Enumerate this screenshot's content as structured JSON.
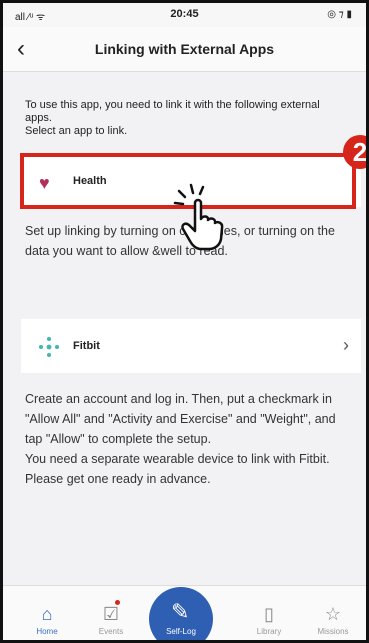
{
  "status_bar": {
    "signal": "all ⁄ᵘ ᯤ",
    "time": "20:45",
    "battery": "◎ ⁊ ▮"
  },
  "header": {
    "title": "Linking with External Apps"
  },
  "intro": {
    "text": "To use this app, you need to link it with the following external apps.\nSelect an app to link."
  },
  "apps": [
    {
      "label": "Health",
      "description": "Set up linking by turning on categories, or turning on the data you want to allow &well to read."
    },
    {
      "label": "Fitbit",
      "description": "Create an account and log in. Then, put a checkmark in \"Allow All\" and \"Activity and Exercise\" and \"Weight\", and tap \"Allow\" to complete the setup.\nYou need a separate wearable device to link with Fitbit. Please get one ready in advance."
    }
  ],
  "annotation": {
    "step": "2"
  },
  "tabbar": {
    "home": "Home",
    "events": "Events",
    "self_log": "Self-Log",
    "library": "Library",
    "missions": "Missions"
  },
  "colors": {
    "accent": "#2e5fb3",
    "highlight": "#d6261b",
    "heart": "#b0305c",
    "fitbit": "#40b8ad"
  }
}
